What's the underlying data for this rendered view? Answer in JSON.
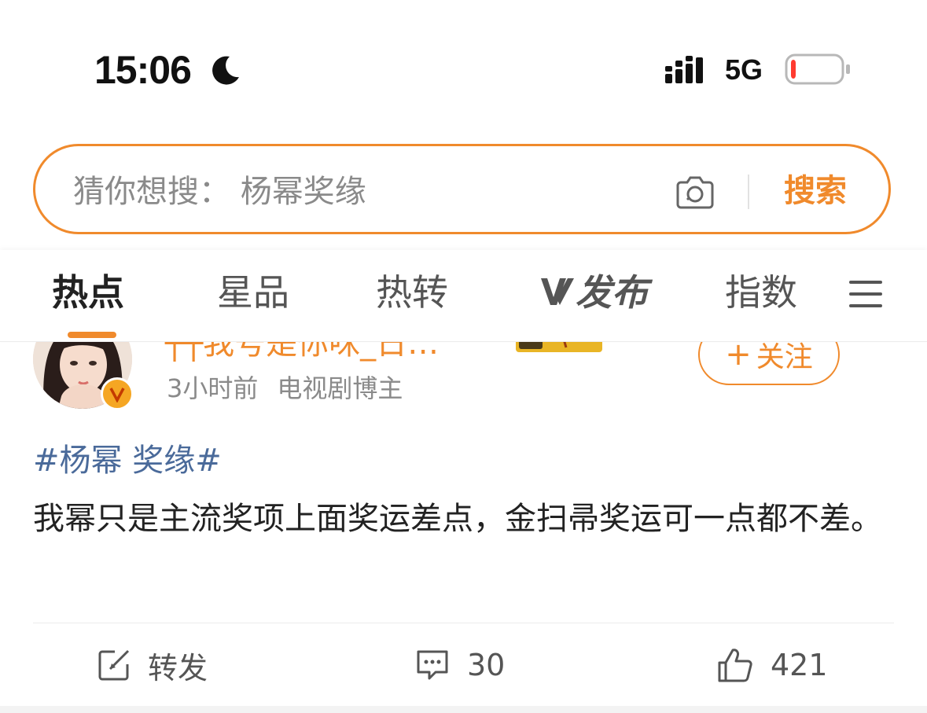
{
  "status_bar": {
    "time": "15:06",
    "network": "5G",
    "battery_level": 0.08,
    "battery_color": "#ff3b30"
  },
  "search": {
    "placeholder": "猜你想搜：  杨幂奖缘",
    "button_label": "搜索",
    "accent_color": "#f08a2c"
  },
  "tabs": [
    {
      "label": "热点",
      "active": true
    },
    {
      "label": "星品",
      "active": false
    },
    {
      "label": "热转",
      "active": false
    },
    {
      "label": "发布",
      "logo": "vplus-logo",
      "active": false
    },
    {
      "label": "指数",
      "active": false
    }
  ],
  "post": {
    "username": "┬┬我号是你咪_日…",
    "time_ago": "3小时前",
    "author_type": "电视剧博主",
    "follow_label": "关注",
    "hashtag": "#杨幂 奖缘#",
    "text": "我幂只是主流奖项上面奖运差点，金扫帚奖运可一点都不差。",
    "actions": {
      "repost_label": "转发",
      "comment_count": "30",
      "like_count": "421"
    }
  },
  "icons": [
    "moon-icon",
    "signal-icon",
    "battery-icon",
    "camera-icon",
    "menu-icon",
    "verified-icon",
    "repost-icon",
    "comment-icon",
    "like-icon"
  ]
}
